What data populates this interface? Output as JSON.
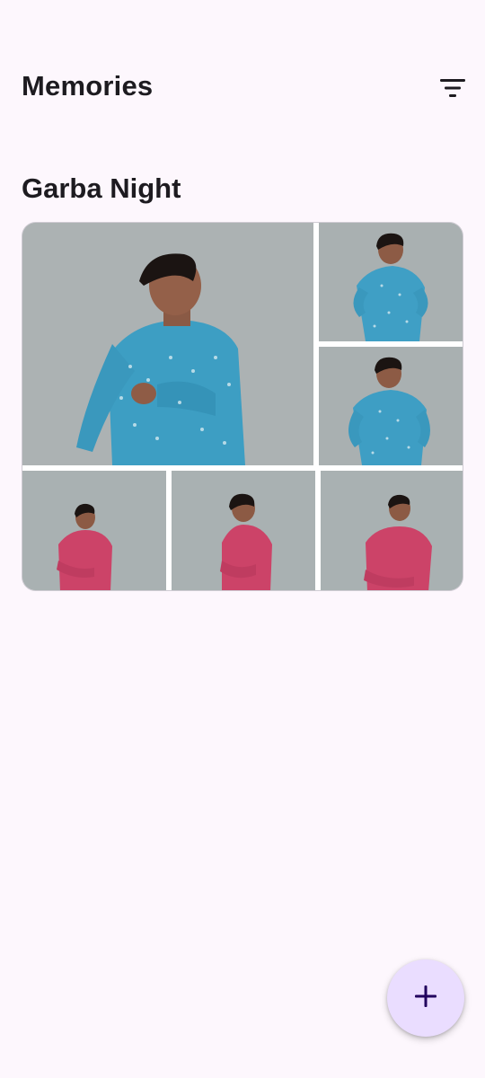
{
  "header": {
    "title": "Memories",
    "filter_icon": "filter-list-icon"
  },
  "album": {
    "title": "Garba Night",
    "photo_count_shown": 6,
    "photos": [
      {
        "subject": "man in blue printed kurta, looking down",
        "kurta_color": "#3c9fc4"
      },
      {
        "subject": "man in blue printed kurta, hands on hips",
        "kurta_color": "#3c9fc4"
      },
      {
        "subject": "man in blue printed kurta, looking aside",
        "kurta_color": "#3c9fc4"
      },
      {
        "subject": "man in pink printed kurta, arms crossed",
        "kurta_color": "#d0456a"
      },
      {
        "subject": "man in pink printed kurta, looking down",
        "kurta_color": "#d0456a"
      },
      {
        "subject": "man in pink printed kurta, smiling",
        "kurta_color": "#d0456a"
      }
    ]
  },
  "fab": {
    "icon": "add-icon",
    "color": "#eaddff"
  },
  "colors": {
    "background": "#fdf7fd",
    "wall": "#a9b0b1",
    "text": "#1d1b20"
  }
}
